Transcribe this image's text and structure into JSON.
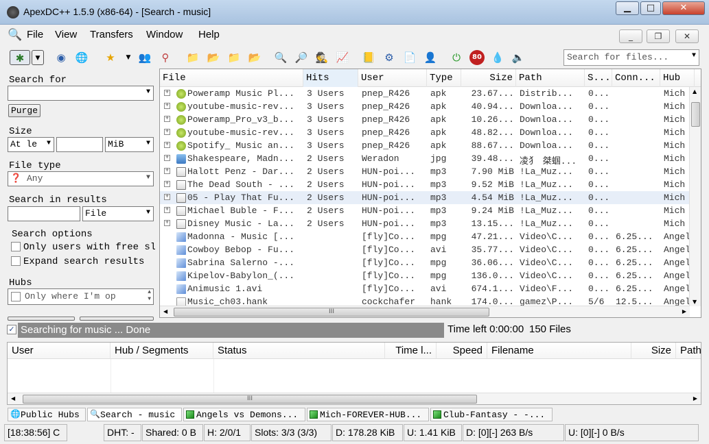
{
  "window": {
    "title": "ApexDC++ 1.5.9 (x86-64) - [Search - music]"
  },
  "menu": [
    "File",
    "View",
    "Transfers",
    "Window",
    "Help"
  ],
  "toolbar_search": {
    "placeholder": "Search for files..."
  },
  "left": {
    "search_for_label": "Search for",
    "search_for_value": "",
    "purge_label": "Purge",
    "size_label": "Size",
    "size_mode": "At le",
    "size_value": "",
    "size_unit": "MiB",
    "file_type_label": "File type",
    "file_type_value": "Any",
    "search_in_results_label": "Search in results",
    "search_in_results_value": "",
    "search_in_results_field": "File",
    "search_options_label": "Search options",
    "opt_free_slots": "Only users with free slo",
    "opt_expand": "Expand search results",
    "hubs_label": "Hubs",
    "hubs_only_op": "Only where I'm op"
  },
  "results": {
    "columns": [
      "File",
      "Hits",
      "User",
      "Type",
      "Size",
      "Path",
      "S...",
      "Conn...",
      "Hub"
    ],
    "rows": [
      {
        "expand": true,
        "icon": "android",
        "file": "Poweramp Music Pl...",
        "hits": "3 Users",
        "user": "pnep_R426",
        "type": "apk",
        "size": "23.67...",
        "path": "Distrib...",
        "slots": "0...",
        "conn": "",
        "hub": "Mich"
      },
      {
        "expand": true,
        "icon": "android",
        "file": "youtube-music-rev...",
        "hits": "3 Users",
        "user": "pnep_R426",
        "type": "apk",
        "size": "40.94...",
        "path": "Downloa...",
        "slots": "0...",
        "conn": "",
        "hub": "Mich"
      },
      {
        "expand": true,
        "icon": "android",
        "file": "Poweramp_Pro_v3_b...",
        "hits": "3 Users",
        "user": "pnep_R426",
        "type": "apk",
        "size": "10.26...",
        "path": "Downloa...",
        "slots": "0...",
        "conn": "",
        "hub": "Mich"
      },
      {
        "expand": true,
        "icon": "android",
        "file": "youtube-music-rev...",
        "hits": "3 Users",
        "user": "pnep_R426",
        "type": "apk",
        "size": "48.82...",
        "path": "Downloa...",
        "slots": "0...",
        "conn": "",
        "hub": "Mich"
      },
      {
        "expand": true,
        "icon": "android",
        "file": "Spotify_ Music an...",
        "hits": "3 Users",
        "user": "pnep_R426",
        "type": "apk",
        "size": "88.67...",
        "path": "Downloa...",
        "slots": "0...",
        "conn": "",
        "hub": "Mich"
      },
      {
        "expand": true,
        "icon": "image",
        "file": "Shakespeare, Madn...",
        "hits": "2 Users",
        "user": "Weradon",
        "type": "jpg",
        "size": "39.48...",
        "path": "凌犭 桀蝈...",
        "slots": "0...",
        "conn": "",
        "hub": "Mich"
      },
      {
        "expand": true,
        "icon": "audio",
        "file": "Halott Penz - Dar...",
        "hits": "2 Users",
        "user": "HUN-poi...",
        "type": "mp3",
        "size": "7.90 MiB",
        "path": "!La_Muz...",
        "slots": "0...",
        "conn": "",
        "hub": "Mich"
      },
      {
        "expand": true,
        "icon": "audio",
        "file": "The Dead South - ...",
        "hits": "2 Users",
        "user": "HUN-poi...",
        "type": "mp3",
        "size": "9.52 MiB",
        "path": "!La_Muz...",
        "slots": "0...",
        "conn": "",
        "hub": "Mich"
      },
      {
        "expand": true,
        "icon": "audio",
        "file": "05 - Play That Fu...",
        "hits": "2 Users",
        "user": "HUN-poi...",
        "type": "mp3",
        "size": "4.54 MiB",
        "path": "!La_Muz...",
        "slots": "0...",
        "conn": "",
        "hub": "Mich",
        "selected": true
      },
      {
        "expand": true,
        "icon": "audio",
        "file": "Michael Buble - F...",
        "hits": "2 Users",
        "user": "HUN-poi...",
        "type": "mp3",
        "size": "9.24 MiB",
        "path": "!La_Muz...",
        "slots": "0...",
        "conn": "",
        "hub": "Mich"
      },
      {
        "expand": true,
        "icon": "audio",
        "file": "Disney Music - La...",
        "hits": "2 Users",
        "user": "HUN-poi...",
        "type": "mp3",
        "size": "13.15...",
        "path": "!La_Muz...",
        "slots": "0...",
        "conn": "",
        "hub": "Mich"
      },
      {
        "expand": false,
        "icon": "video",
        "file": "Madonna - Music [...",
        "hits": "",
        "user": "[fly]Co...",
        "type": "mpg",
        "size": "47.21...",
        "path": "Video\\C...",
        "slots": "0...",
        "conn": "6.25...",
        "hub": "Angel"
      },
      {
        "expand": false,
        "icon": "video",
        "file": "Cowboy Bebop - Fu...",
        "hits": "",
        "user": "[fly]Co...",
        "type": "avi",
        "size": "35.77...",
        "path": "Video\\C...",
        "slots": "0...",
        "conn": "6.25...",
        "hub": "Angel"
      },
      {
        "expand": false,
        "icon": "video",
        "file": "Sabrina Salerno -...",
        "hits": "",
        "user": "[fly]Co...",
        "type": "mpg",
        "size": "36.06...",
        "path": "Video\\C...",
        "slots": "0...",
        "conn": "6.25...",
        "hub": "Angel"
      },
      {
        "expand": false,
        "icon": "video",
        "file": "Kipelov-Babylon_(...",
        "hits": "",
        "user": "[fly]Co...",
        "type": "mpg",
        "size": "136.0...",
        "path": "Video\\C...",
        "slots": "0...",
        "conn": "6.25...",
        "hub": "Angel"
      },
      {
        "expand": false,
        "icon": "video",
        "file": "Animusic 1.avi",
        "hits": "",
        "user": "[fly]Co...",
        "type": "avi",
        "size": "674.1...",
        "path": "Video\\F...",
        "slots": "0...",
        "conn": "6.25...",
        "hub": "Angel"
      },
      {
        "expand": false,
        "icon": "file",
        "file": "Music_ch03.hank",
        "hits": "",
        "user": "cockchafer",
        "type": "hank",
        "size": "174.0...",
        "path": "gamez\\P...",
        "slots": "5/6",
        "conn": "12.5...",
        "hub": "Angel"
      }
    ]
  },
  "status": {
    "progress_text": "Searching for music ... Done",
    "time_left": "Time left 0:00:00",
    "file_count": "150 Files"
  },
  "transfers": {
    "columns": [
      "User",
      "Hub / Segments",
      "Status",
      "Time l...",
      "Speed",
      "Filename",
      "Size",
      "Path"
    ]
  },
  "tabs": [
    "Public Hubs",
    "Search - music",
    "Angels vs Demons...",
    "Mich-FOREVER-HUB...",
    "Club-Fantasy - -..."
  ],
  "statusbar": {
    "time": "[18:38:56] C",
    "dht": "DHT: -",
    "shared": "Shared: 0 B",
    "hubs": "H: 2/0/1",
    "slots": "Slots: 3/3 (3/3)",
    "down": "D: 178.28 KiB",
    "up": "U: 1.41 KiB",
    "down_rate": "D: [0][-] 263 B/s",
    "up_rate": "U: [0][-] 0 B/s"
  }
}
